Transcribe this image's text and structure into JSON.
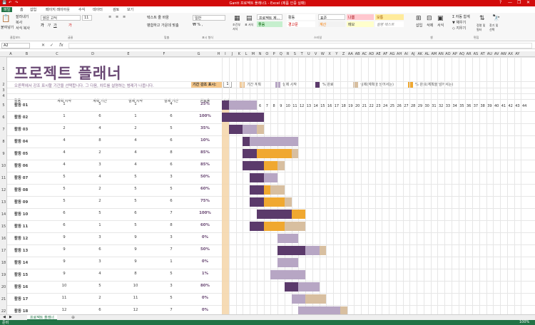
{
  "window": {
    "title": "Gantt 프로젝트 플래너1 - Excel (제품 인증 실패)",
    "controls": [
      "?",
      "—",
      "❐",
      "✕"
    ]
  },
  "ribbon_tabs": [
    "파일",
    "홈",
    "삽입",
    "페이지 레이아웃",
    "수식",
    "데이터",
    "검토",
    "보기"
  ],
  "ribbon": {
    "clipboard": {
      "paste": "붙여넣기",
      "cut": "잘라내기",
      "copy": "복사",
      "format": "서식 복사",
      "label": "클립보드"
    },
    "font": {
      "name": "맑은 고딕",
      "size": "11",
      "label": "글꼴"
    },
    "align": {
      "wrap": "텍스트 줄 바꿈",
      "merge": "병합하고 가운데 맞춤",
      "label": "맞춤"
    },
    "number": {
      "format": "일반",
      "label": "표시 형식"
    },
    "styles": {
      "cond": "조건부 서식",
      "table": "표 서식",
      "cell1": "프로젝트 제...",
      "cell2": "활동",
      "good": "좋음",
      "warn": "경고문",
      "normal": "표준",
      "calc": "계산",
      "bad": "나쁨",
      "memo": "메모",
      "neutral": "보통",
      "explain": "설명 텍스트",
      "label": "스타일"
    },
    "cells": {
      "insert": "삽입",
      "delete": "삭제",
      "format": "서식",
      "label": "셀"
    },
    "edit": {
      "autosum": "자동 합계",
      "fill": "채우기",
      "clear": "지우기",
      "sort": "정렬 및 필터",
      "find": "찾기 및 선택",
      "label": "편집"
    }
  },
  "formula_bar": {
    "name_box": "A2",
    "fx": "fx",
    "value": ""
  },
  "columns": [
    "A",
    "B",
    "C",
    "D",
    "E",
    "F",
    "G",
    "H",
    "I",
    "J",
    "K",
    "L",
    "M",
    "N",
    "O",
    "P",
    "Q",
    "R",
    "S",
    "T",
    "U",
    "V",
    "W",
    "X",
    "Y",
    "Z",
    "AA",
    "AB",
    "AC",
    "AD",
    "AE",
    "AF",
    "AG",
    "AH",
    "AI",
    "AJ",
    "AK",
    "AL",
    "AM",
    "AN",
    "AO",
    "AP",
    "AQ",
    "AR",
    "AS",
    "AT",
    "AU",
    "AV",
    "AW",
    "AX",
    "AY"
  ],
  "rows": [
    "1",
    "2",
    "3",
    "4",
    "5",
    "6",
    "7",
    "8",
    "9",
    "10",
    "11",
    "12",
    "13",
    "14",
    "15",
    "16",
    "17",
    "18",
    "19",
    "20",
    "21",
    "22"
  ],
  "sheet": {
    "title": "프로젝트 플래너",
    "subtitle": "오른쪽에서 강조 표시할 기간을 선택합니다. 그 다음, 차트를 설명하는 범례가 나옵니다.",
    "period_label": "기간 강조 표시:",
    "period_value": "1",
    "legend": [
      "기간 계획",
      "실제 시작",
      "% 완료",
      "실제(계획을 넘어서는)",
      "% 완료(계획을 넘어서는)"
    ],
    "headers": {
      "activity": "활동",
      "plan_start": "계획 시작",
      "plan_dur": "계획 기간",
      "act_start": "실제 시작",
      "act_dur": "실제 기간",
      "pct": "완료율",
      "period": "기간"
    },
    "periods": [
      "1",
      "2",
      "3",
      "4",
      "5",
      "6",
      "7",
      "8",
      "9",
      "10",
      "11",
      "12",
      "13",
      "14",
      "15",
      "16",
      "17",
      "18",
      "19",
      "20",
      "21",
      "22",
      "23",
      "24",
      "25",
      "26",
      "27",
      "28",
      "29",
      "30",
      "31",
      "32",
      "33",
      "34",
      "35",
      "36",
      "37",
      "38",
      "39",
      "40",
      "41",
      "42",
      "43",
      "44"
    ],
    "activities": [
      {
        "name": "활동 01",
        "ps": "1",
        "pd": "5",
        "as": "1",
        "ad": "4",
        "pct": "25%"
      },
      {
        "name": "활동 02",
        "ps": "1",
        "pd": "6",
        "as": "1",
        "ad": "6",
        "pct": "100%"
      },
      {
        "name": "활동 03",
        "ps": "2",
        "pd": "4",
        "as": "2",
        "ad": "5",
        "pct": "35%"
      },
      {
        "name": "활동 04",
        "ps": "4",
        "pd": "8",
        "as": "4",
        "ad": "6",
        "pct": "10%"
      },
      {
        "name": "활동 05",
        "ps": "4",
        "pd": "2",
        "as": "4",
        "ad": "8",
        "pct": "85%"
      },
      {
        "name": "활동 06",
        "ps": "4",
        "pd": "3",
        "as": "4",
        "ad": "6",
        "pct": "85%"
      },
      {
        "name": "활동 07",
        "ps": "5",
        "pd": "4",
        "as": "5",
        "ad": "3",
        "pct": "50%"
      },
      {
        "name": "활동 08",
        "ps": "5",
        "pd": "2",
        "as": "5",
        "ad": "5",
        "pct": "60%"
      },
      {
        "name": "활동 09",
        "ps": "5",
        "pd": "2",
        "as": "5",
        "ad": "6",
        "pct": "75%"
      },
      {
        "name": "활동 10",
        "ps": "6",
        "pd": "5",
        "as": "6",
        "ad": "7",
        "pct": "100%"
      },
      {
        "name": "활동 11",
        "ps": "6",
        "pd": "1",
        "as": "5",
        "ad": "8",
        "pct": "60%"
      },
      {
        "name": "활동 12",
        "ps": "9",
        "pd": "3",
        "as": "9",
        "ad": "3",
        "pct": "0%"
      },
      {
        "name": "활동 13",
        "ps": "9",
        "pd": "6",
        "as": "9",
        "ad": "7",
        "pct": "50%"
      },
      {
        "name": "활동 14",
        "ps": "9",
        "pd": "3",
        "as": "9",
        "ad": "1",
        "pct": "0%"
      },
      {
        "name": "활동 15",
        "ps": "9",
        "pd": "4",
        "as": "8",
        "ad": "5",
        "pct": "1%"
      },
      {
        "name": "활동 16",
        "ps": "10",
        "pd": "5",
        "as": "10",
        "ad": "3",
        "pct": "80%"
      },
      {
        "name": "활동 17",
        "ps": "11",
        "pd": "2",
        "as": "11",
        "ad": "5",
        "pct": "0%"
      },
      {
        "name": "활동 18",
        "ps": "12",
        "pd": "6",
        "as": "12",
        "ad": "7",
        "pct": "0%"
      }
    ]
  },
  "sheet_tab": "프로젝트 플래너",
  "status": {
    "left": "준비",
    "zoom": "100%"
  },
  "colors": {
    "plan": "#b7a6c4",
    "actual": "#5b3a6b",
    "complete": "#e8a33b",
    "beyond": "#d8bfa0",
    "beyond_complete": "#f0a830",
    "period": "#f5d5a8"
  }
}
